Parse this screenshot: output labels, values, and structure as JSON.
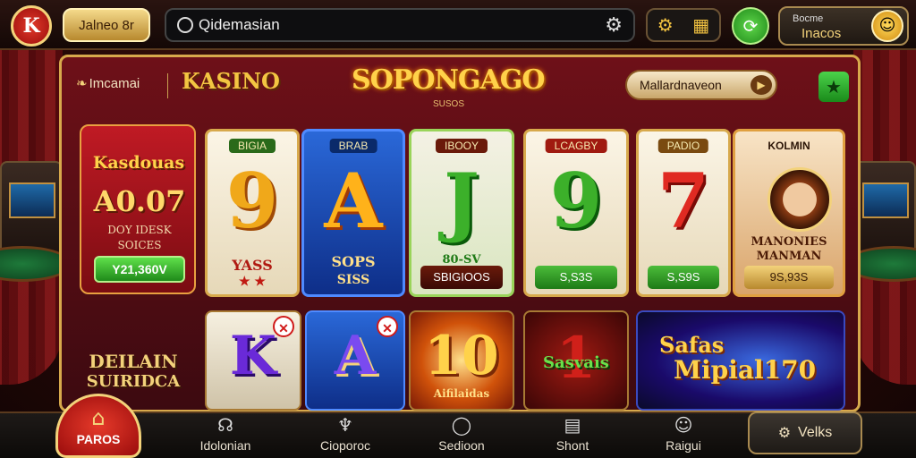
{
  "topbar": {
    "logo_text": "K",
    "user_label": "Jalneo 8r",
    "search_value": "Qidemasian",
    "wallet_line1": "Bocme",
    "wallet_line2": "Inacos"
  },
  "panel": {
    "head_label": "Imcamai",
    "kasino": "KASINO",
    "title": "SOPONGAGO",
    "subtitle": "SUSOS",
    "maker_label": "Mallardnaveon"
  },
  "promo": {
    "title": "Kasdouas",
    "value": "A0.07",
    "line1": "DOY IDESK",
    "line2": "SOICES",
    "button": "Y21,360V"
  },
  "reels": [
    {
      "tag": "BIGIA",
      "symbol": "9",
      "label": "YASS",
      "value": ""
    },
    {
      "tag": "BRAB",
      "symbol": "A",
      "label": "SOPS",
      "label2": "SISS",
      "value": ""
    },
    {
      "tag": "IBOOY",
      "symbol": "J",
      "label": "80-SV",
      "value": "SBIGIOOS"
    },
    {
      "tag": "LCAGBY",
      "symbol": "9",
      "label": "",
      "value": "S,S3S"
    },
    {
      "tag": "PADIO",
      "symbol": "7",
      "label": "",
      "value": "S,S9S"
    },
    {
      "tag": "KOLMIN",
      "symbol": "",
      "label": "MANONIES MANMAN",
      "value": "9S,93S"
    }
  ],
  "row2": {
    "left_line1": "DEILAIN",
    "left_line2": "SUIRIDCA",
    "k": "K",
    "a": "A",
    "ten": "10",
    "ten_sub": "Aifilaidas",
    "sasvais": "Sasvais",
    "safas": "Safas",
    "mipial": "Mipial170"
  },
  "nav": {
    "home": "PAROS",
    "items": [
      "Idolonian",
      "Cioporoc",
      "Sedioon",
      "Shont",
      "Raigui"
    ],
    "vets": "Velks"
  }
}
